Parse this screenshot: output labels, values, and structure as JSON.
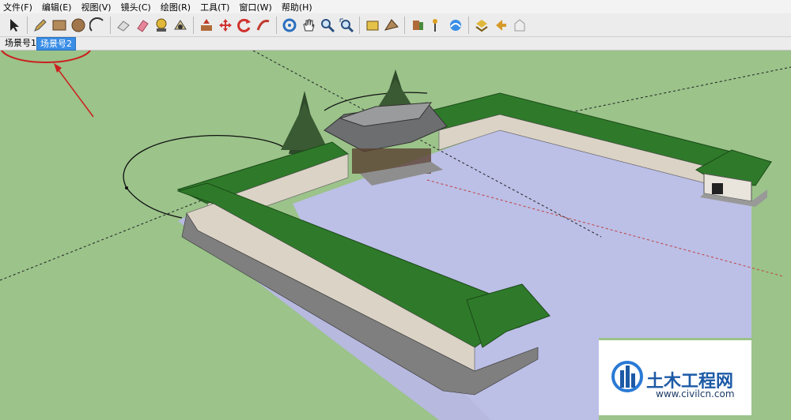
{
  "menu": [
    "文件(F)",
    "编辑(E)",
    "视图(V)",
    "镜头(C)",
    "绘图(R)",
    "工具(T)",
    "窗口(W)",
    "帮助(H)"
  ],
  "scenes": [
    "场景号1",
    "场景号2"
  ],
  "active_scene": "场景号2",
  "toolbar_icons": [
    "select-icon",
    "pencil-icon",
    "rectangle-icon",
    "circle-icon",
    "arc-icon",
    "eraser-icon",
    "paint-icon",
    "tape-measure-icon",
    "protractor-icon",
    "push-pull-icon",
    "move-icon",
    "rotate-icon",
    "follow-me-icon",
    "orbit-icon",
    "pan-icon",
    "zoom-icon",
    "zoom-extents-icon",
    "walk-icon",
    "position-camera-icon",
    "section-plane-icon",
    "axes-icon",
    "dimension-icon",
    "text-icon",
    "previous-view-icon",
    "next-view-icon",
    "component-icon"
  ],
  "watermark": {
    "title": "土木工程网",
    "url": "www.civilcn.com"
  },
  "colors": {
    "ground": "#9bc38a",
    "courtyard": "#bdbfe6",
    "roof": "#2f7a2a",
    "accent": "#3a8ee6",
    "annotation": "#cc1f1f"
  }
}
